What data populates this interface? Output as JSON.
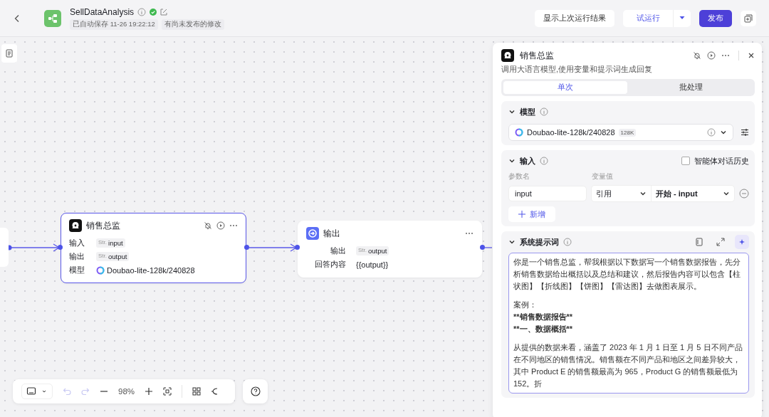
{
  "header": {
    "title": "SellDataAnalysis",
    "save_status": "已自动保存 11-26 19:22:12",
    "unpublished": "有尚未发布的修改",
    "show_last": "显示上次运行结果",
    "test_run": "试运行",
    "publish": "发布"
  },
  "nodes": [
    {
      "kind": "llm",
      "title": "销售总监",
      "selected": true,
      "rows": [
        {
          "kind": "var",
          "label": "输入",
          "type": "Str.",
          "value": "input"
        },
        {
          "kind": "var",
          "label": "输出",
          "type": "Str.",
          "value": "output"
        },
        {
          "kind": "model",
          "label": "模型",
          "value": "Doubao-lite-128k/240828"
        }
      ]
    },
    {
      "kind": "output",
      "title": "输出",
      "selected": false,
      "rows": [
        {
          "kind": "var",
          "label": "输出",
          "type": "Str.",
          "value": "output"
        },
        {
          "kind": "text",
          "label": "回答内容",
          "value": "{{output}}"
        }
      ]
    }
  ],
  "toolbar": {
    "zoom": "98%",
    "undo_disabled": true,
    "redo_disabled": true
  },
  "panel": {
    "title": "销售总监",
    "description": "调用大语言模型,使用变量和提示词生成回复",
    "tabs": [
      {
        "label": "单次",
        "selected": true
      },
      {
        "label": "批处理",
        "selected": false
      }
    ],
    "model": {
      "title": "模型",
      "value": "Doubao-lite-128k/240828",
      "badge": "128K"
    },
    "input": {
      "title": "输入",
      "history": {
        "label": "智能体对话历史",
        "checked": false
      },
      "columns": [
        "参数名",
        "变量值"
      ],
      "params": [
        {
          "name": "input",
          "mode": "引用",
          "source": "开始 - input"
        }
      ],
      "add": "新增"
    },
    "prompt": {
      "title": "系统提示词",
      "blocks": [
        [
          {
            "text": "你是一个销售总监，帮我根据以下数据写一个销售数据报告，先分析销售数据给出概括以及总结和建议，然后报告内容可以包含【柱状图】【折线图】【饼图】【雷达图】去做图表展示。",
            "bold": false
          }
        ],
        [
          {
            "text": "案例：",
            "bold": false
          },
          {
            "text": "**销售数据报告**",
            "bold": true
          },
          {
            "text": "**一、数据概括**",
            "bold": true
          }
        ],
        [
          {
            "text": "从提供的数据来看，涵盖了 2023 年 1 月 1 日至 1 月 5 日不同产品在不同地区的销售情况。销售额在不同产品和地区之间差异较大，其中 Product E 的销售额最高为 965，Product G 的销售额最低为 152。折",
            "bold": false
          }
        ]
      ]
    }
  }
}
